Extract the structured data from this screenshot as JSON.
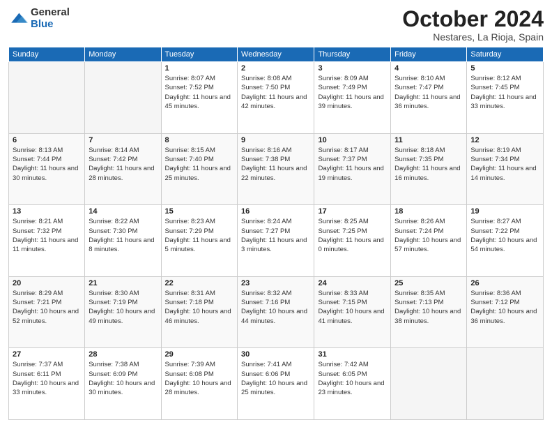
{
  "header": {
    "logo_general": "General",
    "logo_blue": "Blue",
    "month": "October 2024",
    "location": "Nestares, La Rioja, Spain"
  },
  "weekdays": [
    "Sunday",
    "Monday",
    "Tuesday",
    "Wednesday",
    "Thursday",
    "Friday",
    "Saturday"
  ],
  "weeks": [
    [
      {
        "day": "",
        "empty": true
      },
      {
        "day": "",
        "empty": true
      },
      {
        "day": "1",
        "sunrise": "8:07 AM",
        "sunset": "7:52 PM",
        "daylight": "11 hours and 45 minutes."
      },
      {
        "day": "2",
        "sunrise": "8:08 AM",
        "sunset": "7:50 PM",
        "daylight": "11 hours and 42 minutes."
      },
      {
        "day": "3",
        "sunrise": "8:09 AM",
        "sunset": "7:49 PM",
        "daylight": "11 hours and 39 minutes."
      },
      {
        "day": "4",
        "sunrise": "8:10 AM",
        "sunset": "7:47 PM",
        "daylight": "11 hours and 36 minutes."
      },
      {
        "day": "5",
        "sunrise": "8:12 AM",
        "sunset": "7:45 PM",
        "daylight": "11 hours and 33 minutes."
      }
    ],
    [
      {
        "day": "6",
        "sunrise": "8:13 AM",
        "sunset": "7:44 PM",
        "daylight": "11 hours and 30 minutes."
      },
      {
        "day": "7",
        "sunrise": "8:14 AM",
        "sunset": "7:42 PM",
        "daylight": "11 hours and 28 minutes."
      },
      {
        "day": "8",
        "sunrise": "8:15 AM",
        "sunset": "7:40 PM",
        "daylight": "11 hours and 25 minutes."
      },
      {
        "day": "9",
        "sunrise": "8:16 AM",
        "sunset": "7:38 PM",
        "daylight": "11 hours and 22 minutes."
      },
      {
        "day": "10",
        "sunrise": "8:17 AM",
        "sunset": "7:37 PM",
        "daylight": "11 hours and 19 minutes."
      },
      {
        "day": "11",
        "sunrise": "8:18 AM",
        "sunset": "7:35 PM",
        "daylight": "11 hours and 16 minutes."
      },
      {
        "day": "12",
        "sunrise": "8:19 AM",
        "sunset": "7:34 PM",
        "daylight": "11 hours and 14 minutes."
      }
    ],
    [
      {
        "day": "13",
        "sunrise": "8:21 AM",
        "sunset": "7:32 PM",
        "daylight": "11 hours and 11 minutes."
      },
      {
        "day": "14",
        "sunrise": "8:22 AM",
        "sunset": "7:30 PM",
        "daylight": "11 hours and 8 minutes."
      },
      {
        "day": "15",
        "sunrise": "8:23 AM",
        "sunset": "7:29 PM",
        "daylight": "11 hours and 5 minutes."
      },
      {
        "day": "16",
        "sunrise": "8:24 AM",
        "sunset": "7:27 PM",
        "daylight": "11 hours and 3 minutes."
      },
      {
        "day": "17",
        "sunrise": "8:25 AM",
        "sunset": "7:25 PM",
        "daylight": "11 hours and 0 minutes."
      },
      {
        "day": "18",
        "sunrise": "8:26 AM",
        "sunset": "7:24 PM",
        "daylight": "10 hours and 57 minutes."
      },
      {
        "day": "19",
        "sunrise": "8:27 AM",
        "sunset": "7:22 PM",
        "daylight": "10 hours and 54 minutes."
      }
    ],
    [
      {
        "day": "20",
        "sunrise": "8:29 AM",
        "sunset": "7:21 PM",
        "daylight": "10 hours and 52 minutes."
      },
      {
        "day": "21",
        "sunrise": "8:30 AM",
        "sunset": "7:19 PM",
        "daylight": "10 hours and 49 minutes."
      },
      {
        "day": "22",
        "sunrise": "8:31 AM",
        "sunset": "7:18 PM",
        "daylight": "10 hours and 46 minutes."
      },
      {
        "day": "23",
        "sunrise": "8:32 AM",
        "sunset": "7:16 PM",
        "daylight": "10 hours and 44 minutes."
      },
      {
        "day": "24",
        "sunrise": "8:33 AM",
        "sunset": "7:15 PM",
        "daylight": "10 hours and 41 minutes."
      },
      {
        "day": "25",
        "sunrise": "8:35 AM",
        "sunset": "7:13 PM",
        "daylight": "10 hours and 38 minutes."
      },
      {
        "day": "26",
        "sunrise": "8:36 AM",
        "sunset": "7:12 PM",
        "daylight": "10 hours and 36 minutes."
      }
    ],
    [
      {
        "day": "27",
        "sunrise": "7:37 AM",
        "sunset": "6:11 PM",
        "daylight": "10 hours and 33 minutes."
      },
      {
        "day": "28",
        "sunrise": "7:38 AM",
        "sunset": "6:09 PM",
        "daylight": "10 hours and 30 minutes."
      },
      {
        "day": "29",
        "sunrise": "7:39 AM",
        "sunset": "6:08 PM",
        "daylight": "10 hours and 28 minutes."
      },
      {
        "day": "30",
        "sunrise": "7:41 AM",
        "sunset": "6:06 PM",
        "daylight": "10 hours and 25 minutes."
      },
      {
        "day": "31",
        "sunrise": "7:42 AM",
        "sunset": "6:05 PM",
        "daylight": "10 hours and 23 minutes."
      },
      {
        "day": "",
        "empty": true
      },
      {
        "day": "",
        "empty": true
      }
    ]
  ]
}
